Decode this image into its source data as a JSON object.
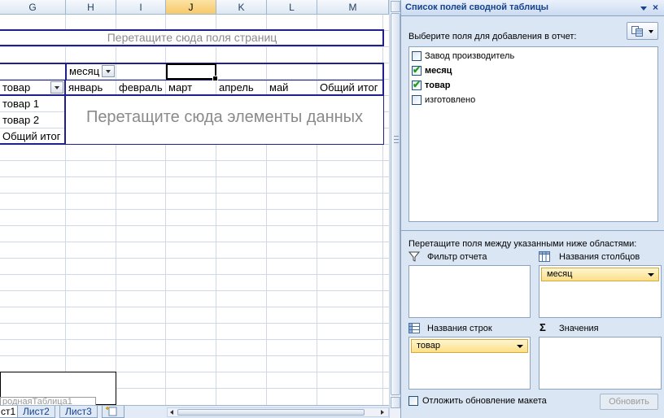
{
  "sheet": {
    "columns": [
      "G",
      "H",
      "I",
      "J",
      "K",
      "L",
      "M"
    ],
    "selected_column": "J",
    "page_fields_placeholder": "Перетащите сюда поля страниц",
    "column_field": {
      "label": "месяц"
    },
    "row_field": {
      "label": "товар"
    },
    "column_items": [
      "январь",
      "февраль",
      "март",
      "апрель",
      "май",
      "Общий итог"
    ],
    "row_items": [
      "товар 1",
      "товар 2",
      "Общий итог"
    ],
    "data_placeholder": "Перетащите сюда элементы данных",
    "shape_caption": "роднаяТаблица1",
    "tabs": [
      "ст1",
      "Лист2",
      "Лист3"
    ],
    "active_tab": "ст1"
  },
  "panel": {
    "title": "Список полей сводной таблицы",
    "close_glyph": "×",
    "choose_label": "Выберите поля для добавления в отчет:",
    "fields": [
      {
        "label": "Завод производитель",
        "checked": false
      },
      {
        "label": "месяц",
        "checked": true
      },
      {
        "label": "товар",
        "checked": true
      },
      {
        "label": "изготовлено",
        "checked": false
      }
    ],
    "drag_label": "Перетащите поля между указанными ниже областями:",
    "areas": {
      "report_filter": {
        "title": "Фильтр отчета",
        "icon": "filter-icon",
        "items": []
      },
      "column_labels": {
        "title": "Названия столбцов",
        "icon": "column-labels-icon",
        "items": [
          "месяц"
        ]
      },
      "row_labels": {
        "title": "Названия строк",
        "icon": "row-labels-icon",
        "items": [
          "товар"
        ]
      },
      "values": {
        "title": "Значения",
        "icon": "sigma-icon",
        "glyph": "Σ",
        "items": []
      }
    },
    "defer_label": "Отложить обновление макета",
    "update_label": "Обновить"
  },
  "colors": {
    "pivot_border": "#1f1f8f",
    "panel_bg": "#dbe6f4",
    "header_text": "#15428b",
    "pill": "#fbe08a",
    "check_green": "#1e9a1e"
  }
}
